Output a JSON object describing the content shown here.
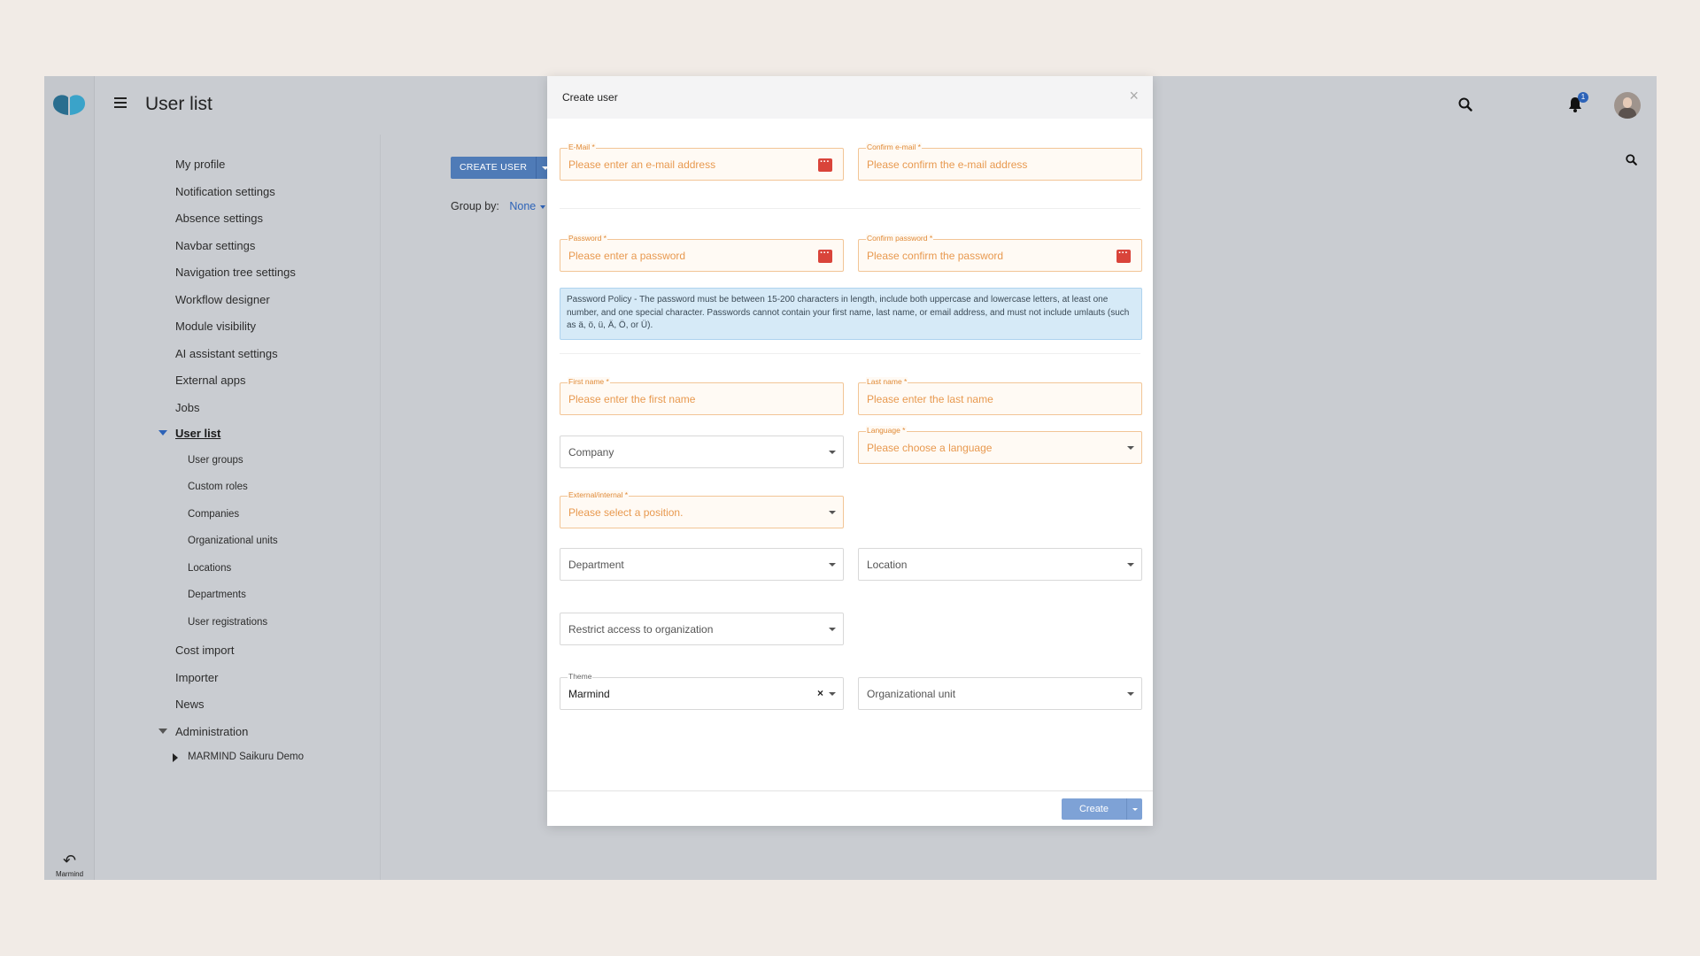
{
  "app": {
    "title": "User list",
    "rail_back_label": "Marmind",
    "notification_count": "1"
  },
  "sidebar": {
    "items": [
      {
        "label": "My profile"
      },
      {
        "label": "Notification settings"
      },
      {
        "label": "Absence settings"
      },
      {
        "label": "Navbar settings"
      },
      {
        "label": "Navigation tree settings"
      },
      {
        "label": "Workflow designer"
      },
      {
        "label": "Module visibility"
      },
      {
        "label": "AI assistant settings"
      },
      {
        "label": "External apps"
      },
      {
        "label": "Jobs"
      },
      {
        "label": "User list"
      },
      {
        "label": "User groups"
      },
      {
        "label": "Custom roles"
      },
      {
        "label": "Companies"
      },
      {
        "label": "Organizational units"
      },
      {
        "label": "Locations"
      },
      {
        "label": "Departments"
      },
      {
        "label": "User registrations"
      },
      {
        "label": "Cost import"
      },
      {
        "label": "Importer"
      },
      {
        "label": "News"
      },
      {
        "label": "Administration"
      },
      {
        "label": "MARMIND Saikuru Demo"
      }
    ]
  },
  "content": {
    "create_user_label": "CREATE USER",
    "group_by_label": "Group by:",
    "group_by_value": "None"
  },
  "modal": {
    "title": "Create user",
    "fields": {
      "email": {
        "label": "E-Mail *",
        "placeholder": "Please enter an e-mail address"
      },
      "confirm_email": {
        "label": "Confirm e-mail *",
        "placeholder": "Please confirm the e-mail address"
      },
      "password": {
        "label": "Password *",
        "placeholder": "Please enter a password"
      },
      "confirm_password": {
        "label": "Confirm password *",
        "placeholder": "Please confirm the password"
      },
      "first_name": {
        "label": "First name *",
        "placeholder": "Please enter the first name"
      },
      "last_name": {
        "label": "Last name *",
        "placeholder": "Please enter the last name"
      },
      "company": {
        "placeholder": "Company"
      },
      "language": {
        "label": "Language *",
        "placeholder": "Please choose a language"
      },
      "position": {
        "label": "External/internal *",
        "placeholder": "Please select a position."
      },
      "department": {
        "placeholder": "Department"
      },
      "location": {
        "placeholder": "Location"
      },
      "restrict_access": {
        "placeholder": "Restrict access to organization"
      },
      "theme": {
        "label": "Theme",
        "value": "Marmind"
      },
      "org_unit": {
        "placeholder": "Organizational unit"
      }
    },
    "password_policy": "Password Policy - The password must be between 15-200 characters in length, include both uppercase and lowercase letters, at least one number, and one special character. Passwords cannot contain your first name, last name, or email address, and must not include umlauts (such as ä, ö, ü, Ä, Ö, or Ü).",
    "create_label": "Create"
  },
  "colors": {
    "accent": "#2d63b8",
    "required_border": "#f2c596",
    "required_text": "#e8994f",
    "password_icon": "#d9443a"
  }
}
